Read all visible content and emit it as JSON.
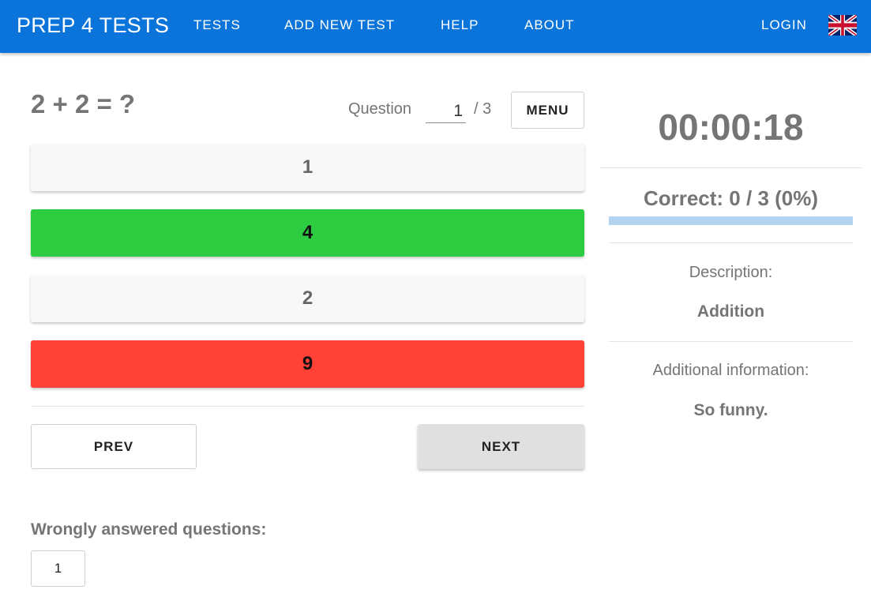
{
  "nav": {
    "brand": "PREP 4 TESTS",
    "links": [
      "TESTS",
      "ADD NEW TEST",
      "HELP",
      "ABOUT"
    ],
    "login": "LOGIN",
    "language_icon": "uk-flag-icon"
  },
  "question": {
    "title": "2 + 2 = ?",
    "counter_label": "Question",
    "current": "1",
    "total_text": "/ 3",
    "menu_label": "MENU"
  },
  "answers": [
    {
      "label": "1",
      "state": "neutral"
    },
    {
      "label": "4",
      "state": "correct"
    },
    {
      "label": "2",
      "state": "neutral"
    },
    {
      "label": "9",
      "state": "wrong"
    }
  ],
  "navigation": {
    "prev_label": "PREV",
    "next_label": "NEXT"
  },
  "wrong_answers": {
    "heading": "Wrongly answered questions:",
    "items": [
      "1"
    ]
  },
  "sidebar": {
    "timer": "00:00:18",
    "score_text": "Correct:  0 / 3 (0%)",
    "progress": 0,
    "description_label": "Description:",
    "description_value": "Addition",
    "additional_label": "Additional information:",
    "additional_value": "So funny."
  },
  "colors": {
    "primary": "#0a74da",
    "correct": "#2ecc40",
    "wrong": "#ff4136",
    "neutral": "#f8f8f8"
  }
}
